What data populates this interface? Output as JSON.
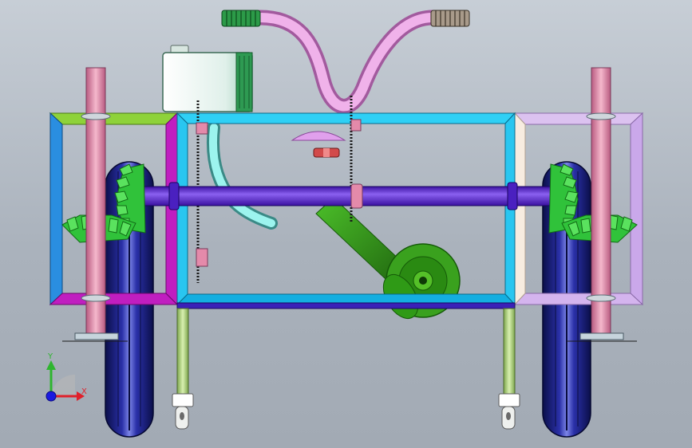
{
  "viewport": {
    "background_top": "#c7ced6",
    "background_bottom": "#a2aab4"
  },
  "triad": {
    "x_label": "X",
    "y_label": "Y",
    "x_color": "#e0202a",
    "y_color": "#2fb52f",
    "z_color": "#1a1ae0"
  },
  "model": {
    "frame_color": "#18c4ee",
    "left_box_color": "#2a8ee0",
    "left_top_color": "#8ed23a",
    "left_bottom_color": "#c01ec0",
    "right_box_color": "#d6b8ee",
    "axle_color": "#5a20d8",
    "post_color": "#e48aaa",
    "wheel_color": "#141a6e",
    "gear_color": "#35d03a",
    "handlebar_color": "#e892e2",
    "grip_color": "#2c9a48",
    "tank_color": "#e6f3ee",
    "hose_color": "#6ee8e0",
    "motor_color": "#3aa11e",
    "leg_color": "#b2d68a",
    "cap_color": "#d24a4a"
  }
}
